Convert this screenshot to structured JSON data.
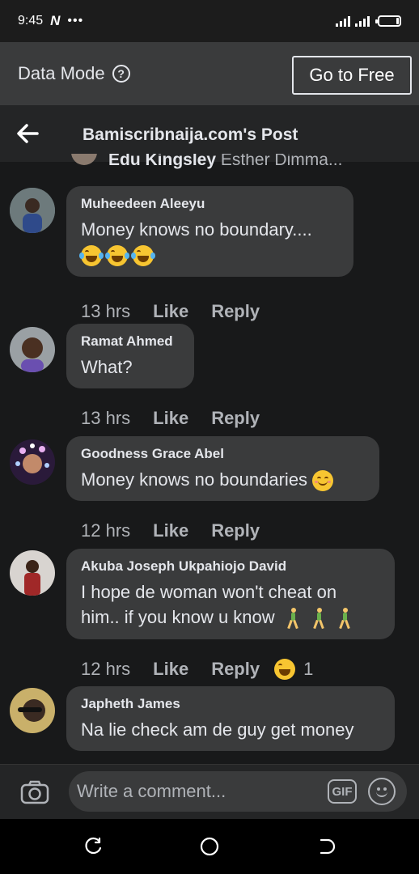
{
  "status_bar": {
    "time": "9:45",
    "app_badge": "N",
    "dots": "•••",
    "network": "4G"
  },
  "data_mode": {
    "label": "Data Mode",
    "help": "?",
    "button": "Go to Free"
  },
  "header": {
    "title": "Bamiscribnaija.com's Post"
  },
  "peek": {
    "author": "Edu Kingsley",
    "text": "Esther Dimma..."
  },
  "comments": [
    {
      "author": "Muheedeen Aleeyu",
      "text": "Money knows no boundary....",
      "time": "13 hrs",
      "like": "Like",
      "reply": "Reply"
    },
    {
      "author": "Ramat Ahmed",
      "text": "What?",
      "time": "13 hrs",
      "like": "Like",
      "reply": "Reply"
    },
    {
      "author": "Goodness Grace Abel",
      "text": "Money knows no boundaries",
      "time": "12 hrs",
      "like": "Like",
      "reply": "Reply"
    },
    {
      "author": "Akuba Joseph Ukpahiojo David",
      "text_line1": "I hope de woman won't cheat on",
      "text_line2": "him.. if you know u know",
      "time": "12 hrs",
      "like": "Like",
      "reply": "Reply",
      "reaction_count": "1"
    },
    {
      "author": "Japheth James",
      "text": "Na lie check am de guy get money"
    }
  ],
  "composer": {
    "placeholder": "Write a comment...",
    "gif": "GIF"
  },
  "colors": {
    "background": "#18191a",
    "bubble": "#3a3b3c",
    "text": "#e4e6eb",
    "muted": "#b0b3b8"
  }
}
